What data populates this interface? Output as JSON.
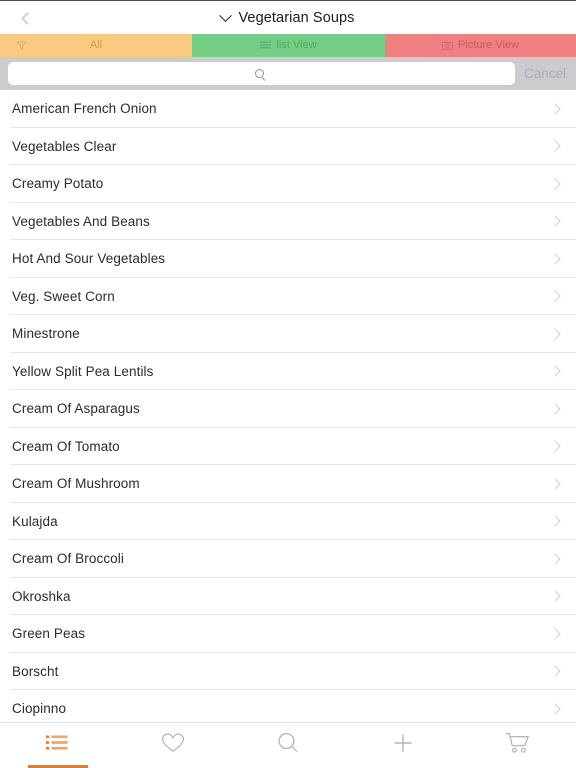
{
  "header": {
    "back_icon": "chevron-left-icon",
    "title": "Vegetarian Soups",
    "title_chevron_icon": "chevron-down-icon"
  },
  "segmented_tabs": [
    {
      "id": "all",
      "label": "All",
      "icon": "filter-funnel-icon",
      "bg": "#f7cc80",
      "fg": "#c99c4d",
      "selected": false
    },
    {
      "id": "list",
      "label": "list View",
      "icon": "list-view-icon",
      "bg": "#74ce86",
      "fg": "#4da862",
      "selected": true
    },
    {
      "id": "picture",
      "label": "Picture View",
      "icon": "camera-icon",
      "bg": "#f08080",
      "fg": "#c95c5c",
      "selected": false
    }
  ],
  "search": {
    "icon": "search-icon",
    "value": "",
    "placeholder": "",
    "cancel_label": "Cancel"
  },
  "list": {
    "disclosure_icon": "chevron-right-icon",
    "items": [
      {
        "label": "American French Onion"
      },
      {
        "label": "Vegetables Clear"
      },
      {
        "label": "Creamy Potato"
      },
      {
        "label": "Vegetables And Beans"
      },
      {
        "label": "Hot And Sour Vegetables"
      },
      {
        "label": "Veg. Sweet Corn"
      },
      {
        "label": "Minestrone"
      },
      {
        "label": "Yellow Split Pea Lentils"
      },
      {
        "label": "Cream Of Asparagus"
      },
      {
        "label": "Cream Of Tomato"
      },
      {
        "label": "Cream Of Mushroom"
      },
      {
        "label": "Kulajda"
      },
      {
        "label": "Cream Of Broccoli"
      },
      {
        "label": "Okroshka"
      },
      {
        "label": "Green Peas"
      },
      {
        "label": "Borscht"
      },
      {
        "label": "Ciopinno"
      }
    ]
  },
  "bottom_tabs": {
    "active_color": "#f07818",
    "inactive_color": "#b4b4b8",
    "items": [
      {
        "id": "list",
        "icon": "list-bullets-icon",
        "active": true
      },
      {
        "id": "favorites",
        "icon": "heart-icon",
        "active": false
      },
      {
        "id": "search",
        "icon": "search-icon",
        "active": false
      },
      {
        "id": "add",
        "icon": "plus-icon",
        "active": false
      },
      {
        "id": "cart",
        "icon": "shopping-cart-icon",
        "active": false
      }
    ]
  }
}
